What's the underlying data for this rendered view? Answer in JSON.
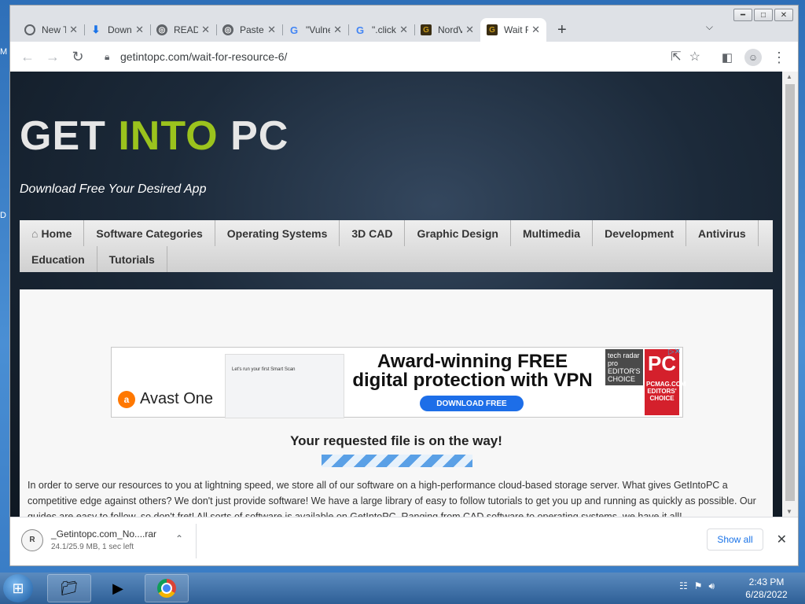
{
  "desktop": {
    "edge_labels": [
      "M",
      "D"
    ]
  },
  "window": {
    "controls": [
      "minimize",
      "maximize",
      "close"
    ]
  },
  "tabs": [
    {
      "title": "New Tab",
      "icon": "chrome-icon",
      "fav_color": "#5f6368",
      "active": false
    },
    {
      "title": "Downloads",
      "icon": "download-icon",
      "fav_color": "#1a73e8",
      "active": false
    },
    {
      "title": "README",
      "icon": "globe-icon",
      "fav_color": "#5f6368",
      "active": false
    },
    {
      "title": "Pastebin",
      "icon": "globe-icon",
      "fav_color": "#5f6368",
      "active": false
    },
    {
      "title": "\"Vulnerability",
      "icon": "google-icon",
      "fav_color": "#4285f4",
      "active": false
    },
    {
      "title": "\".click",
      "icon": "google-icon",
      "fav_color": "#4285f4",
      "active": false
    },
    {
      "title": "NordVPN",
      "icon": "getintopc-icon",
      "fav_color": "#c79a1a",
      "active": false
    },
    {
      "title": "Wait For Resource",
      "icon": "getintopc-icon",
      "fav_color": "#c79a1a",
      "active": true
    }
  ],
  "address_bar": {
    "url": "getintopc.com/wait-for-resource-6/"
  },
  "site": {
    "logo": {
      "part1": "GET ",
      "part2": "INTO",
      "part3": " PC"
    },
    "tagline": "Download Free Your Desired App",
    "nav": [
      [
        "Home",
        "Software Categories",
        "Operating Systems",
        "3D CAD",
        "Graphic Design",
        "Multimedia",
        "Development",
        "Antivirus"
      ],
      [
        "Education",
        "Tutorials"
      ]
    ],
    "ad": {
      "brand": "Avast One",
      "headline_1": "Award-winning FREE",
      "headline_2": "digital protection with VPN",
      "cta": "DOWNLOAD FREE",
      "badge_1": "tech radar pro EDITOR'S CHOICE",
      "badge_2_top": "PC",
      "badge_2_bottom": "PCMAG.COM EDITORS' CHOICE",
      "screenshot_text": "Let's run your first Smart Scan"
    },
    "requested": "Your requested file is on the way!",
    "paragraph": "In order to serve our resources to you at lightning speed, we store all of our software on a high-performance cloud-based storage server. What gives GetIntoPC a competitive edge against others? We don't just provide software! We have a large library of easy to follow tutorials to get you up and running as quickly as possible. Our guides are easy to follow, so don't fret! All sorts of software is available on GetIntoPC. Ranging from CAD software to operating systems, we have it all!"
  },
  "download": {
    "filename": "_Getintopc.com_No....rar",
    "status": "24.1/25.9 MB, 1 sec left",
    "show_all": "Show all"
  },
  "taskbar": {
    "time": "2:43 PM",
    "date": "6/28/2022"
  }
}
